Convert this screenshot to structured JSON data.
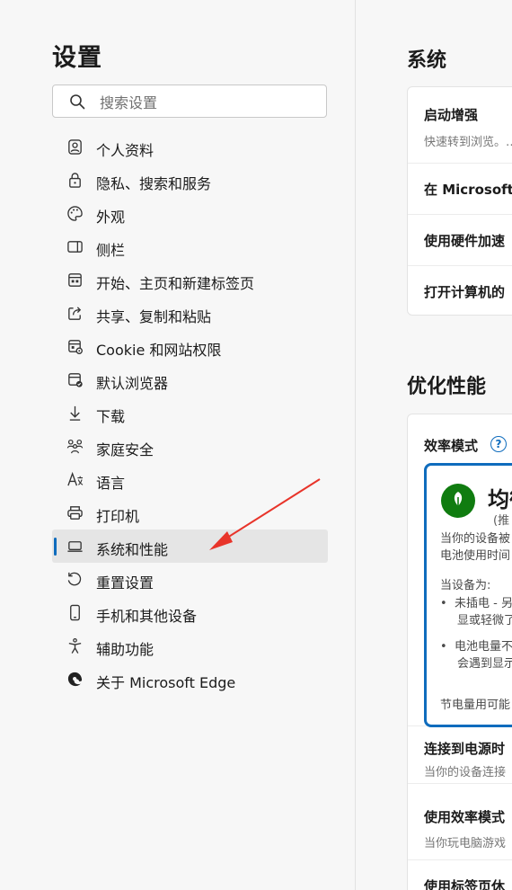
{
  "sidebar": {
    "title": "设置",
    "search_placeholder": "搜索设置",
    "items": [
      {
        "label": "个人资料",
        "icon": "profile-icon"
      },
      {
        "label": "隐私、搜索和服务",
        "icon": "lock-icon"
      },
      {
        "label": "外观",
        "icon": "palette-icon"
      },
      {
        "label": "侧栏",
        "icon": "sidebar-icon"
      },
      {
        "label": "开始、主页和新建标签页",
        "icon": "home-tabs-icon"
      },
      {
        "label": "共享、复制和粘贴",
        "icon": "share-icon"
      },
      {
        "label": "Cookie 和网站权限",
        "icon": "cookie-permissions-icon"
      },
      {
        "label": "默认浏览器",
        "icon": "default-browser-icon"
      },
      {
        "label": "下载",
        "icon": "download-icon"
      },
      {
        "label": "家庭安全",
        "icon": "family-icon"
      },
      {
        "label": "语言",
        "icon": "language-icon"
      },
      {
        "label": "打印机",
        "icon": "printer-icon"
      },
      {
        "label": "系统和性能",
        "icon": "laptop-icon",
        "active": true
      },
      {
        "label": "重置设置",
        "icon": "reset-icon"
      },
      {
        "label": "手机和其他设备",
        "icon": "phone-icon"
      },
      {
        "label": "辅助功能",
        "icon": "accessibility-icon"
      },
      {
        "label": "关于 Microsoft Edge",
        "icon": "edge-logo-icon"
      }
    ]
  },
  "system": {
    "title": "系统",
    "rows": [
      {
        "title": "启动增强",
        "desc": "快速转到浏览。…"
      },
      {
        "title": "在 Microsoft"
      },
      {
        "title": "使用硬件加速"
      },
      {
        "title": "打开计算机的"
      }
    ]
  },
  "performance": {
    "title": "优化性能",
    "efficiency_title": "效率模式",
    "help_glyph": "?",
    "mode": {
      "title": "均衡",
      "subtitle": "(推",
      "desc_1": "当你的设备被",
      "desc_2": "电池使用时间",
      "when": "当设备为:",
      "bullet_1a": "未插电 - 另",
      "bullet_1b": "显或轻微了",
      "bullet_2a": "电池电量不",
      "bullet_2b": "会遇到显示",
      "footer": "节电量用可能"
    },
    "rows": [
      {
        "title": "连接到电源时",
        "desc": "当你的设备连接"
      },
      {
        "title": "使用效率模式",
        "desc": "当你玩电脑游戏"
      },
      {
        "title": "使用标签页休"
      }
    ]
  },
  "colors": {
    "accent": "#0f6cbd",
    "leaf_green": "#107c10",
    "annotation_arrow": "#e8342a"
  }
}
